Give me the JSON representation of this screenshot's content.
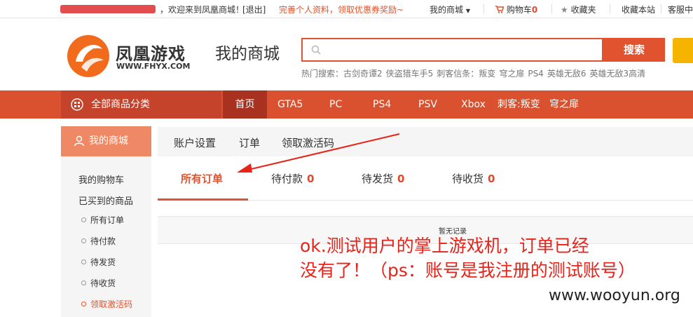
{
  "topbar": {
    "welcome": "，欢迎来到凤凰商城！",
    "logout": "[退出]",
    "promo": "完善个人资料，领取优惠券奖励~",
    "my_mall": "我的商城",
    "cart": "购物车",
    "cart_count": "0",
    "favorites": "收藏夹",
    "bookmark": "收藏本站",
    "service": "客服中"
  },
  "header": {
    "brand_cn": "凤凰游戏",
    "brand_url": "WWW.FHYX.COM",
    "mall_title": "我的商城",
    "search_placeholder": "",
    "search_button": "搜索",
    "hot_label": "热门搜索：",
    "hot_terms": [
      "古剑奇谭2",
      "侠盗猎车手5",
      "刺客信条：叛变",
      "穹之扉",
      "PS4",
      "英雄无敌6",
      "英雄无敌3高清"
    ]
  },
  "nav": {
    "all_categories": "全部商品分类",
    "items": [
      "首页",
      "GTA5",
      "PC",
      "PS4",
      "PSV",
      "Xbox",
      "刺客:叛变",
      "穹之扉"
    ]
  },
  "sidebar": {
    "title": "我的商城",
    "links": [
      "我的购物车",
      "已买到的商品"
    ],
    "sub": [
      "所有订单",
      "待付款",
      "待发货",
      "待收货",
      "领取激活码"
    ]
  },
  "content": {
    "top_tabs": [
      "账户设置",
      "订单",
      "领取激活码"
    ],
    "order_tabs": [
      {
        "label": "所有订单",
        "count": ""
      },
      {
        "label": "待付款",
        "count": "0"
      },
      {
        "label": "待发货",
        "count": "0"
      },
      {
        "label": "待收货",
        "count": "0"
      }
    ],
    "empty": "暂无记录"
  },
  "annotation": {
    "line1": "ok.测试用户的掌上游戏机，订单已经",
    "line2": "没有了！（ps：账号是我注册的测试账号）",
    "watermark": "www.wooyun.org"
  },
  "colors": {
    "accent": "#e0532e",
    "nav_bg": "#d9512f",
    "annotation": "#e8231a"
  }
}
